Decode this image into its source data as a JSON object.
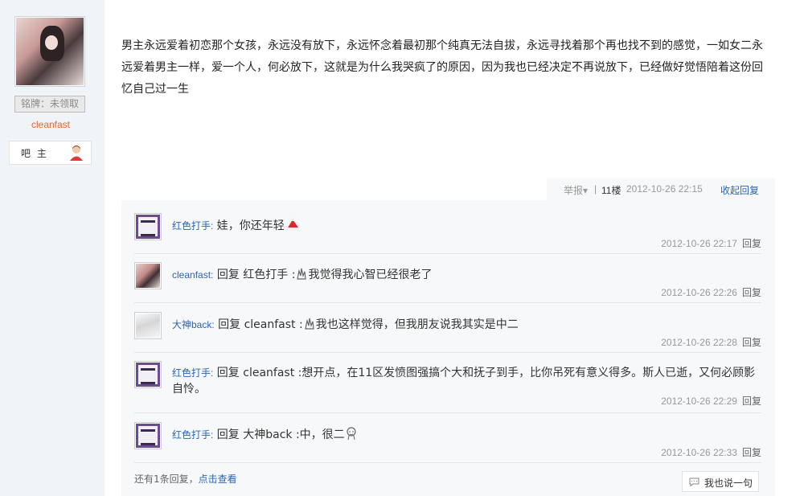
{
  "author": {
    "badge": "铭牌：未领取",
    "name": "cleanfast",
    "role": "吧 主"
  },
  "post": {
    "text": "男主永远爱着初恋那个女孩，永远没有放下，永远怀念着最初那个纯真无法自拔，永远寻找着那个再也找不到的感觉，一如女二永远爱着男主一样，爱一个人，何必放下，这就是为什么我哭疯了的原因，因为我也已经决定不再说放下，已经做好觉悟陪着这份回忆自己过一生"
  },
  "toolbar": {
    "report": "举报▾",
    "sep": "|",
    "floor": "11楼",
    "time": "2012-10-26 22:15",
    "collapse": "收起回复"
  },
  "replies": [
    {
      "user": "红色打手:",
      "text": "娃，你还年轻",
      "time": "2012-10-26 22:17",
      "reply_label": "回复",
      "avatar": "purple-avatar",
      "emoji": "santa-hat-icon"
    },
    {
      "user": "cleanfast:",
      "text": "回复 红色打手 :",
      "text2": "我觉得我心智已经很老了",
      "time": "2012-10-26 22:26",
      "reply_label": "回复",
      "avatar": "girl-avatar",
      "emoji": "gesture-icon"
    },
    {
      "user": "大神back:",
      "text": "回复 cleanfast :",
      "text2": "我也这样觉得，但我朋友说我其实是中二",
      "time": "2012-10-26 22:28",
      "reply_label": "回复",
      "avatar": "sketch-avatar",
      "emoji": "gesture-icon"
    },
    {
      "user": "红色打手:",
      "text": "回复 cleanfast :想开点，在11区发愤图强搞个大和抚子到手，比你吊死有意义得多。斯人已逝，又何必顾影自怜。",
      "time": "2012-10-26 22:29",
      "reply_label": "回复",
      "avatar": "purple-avatar"
    },
    {
      "user": "红色打手:",
      "text": "回复 大神back :中，很二",
      "time": "2012-10-26 22:33",
      "reply_label": "回复",
      "avatar": "purple-avatar",
      "emoji": "doodle-face-icon"
    }
  ],
  "footer": {
    "more_prefix": "还有1条回复，",
    "more_link": "点击查看",
    "say_button": "我也说一句"
  },
  "colors": {
    "link": "#2d64b3",
    "username": "#e46a2f",
    "panel_bg": "#f7f8fa",
    "sidebar_bg": "#f0f3f7"
  }
}
